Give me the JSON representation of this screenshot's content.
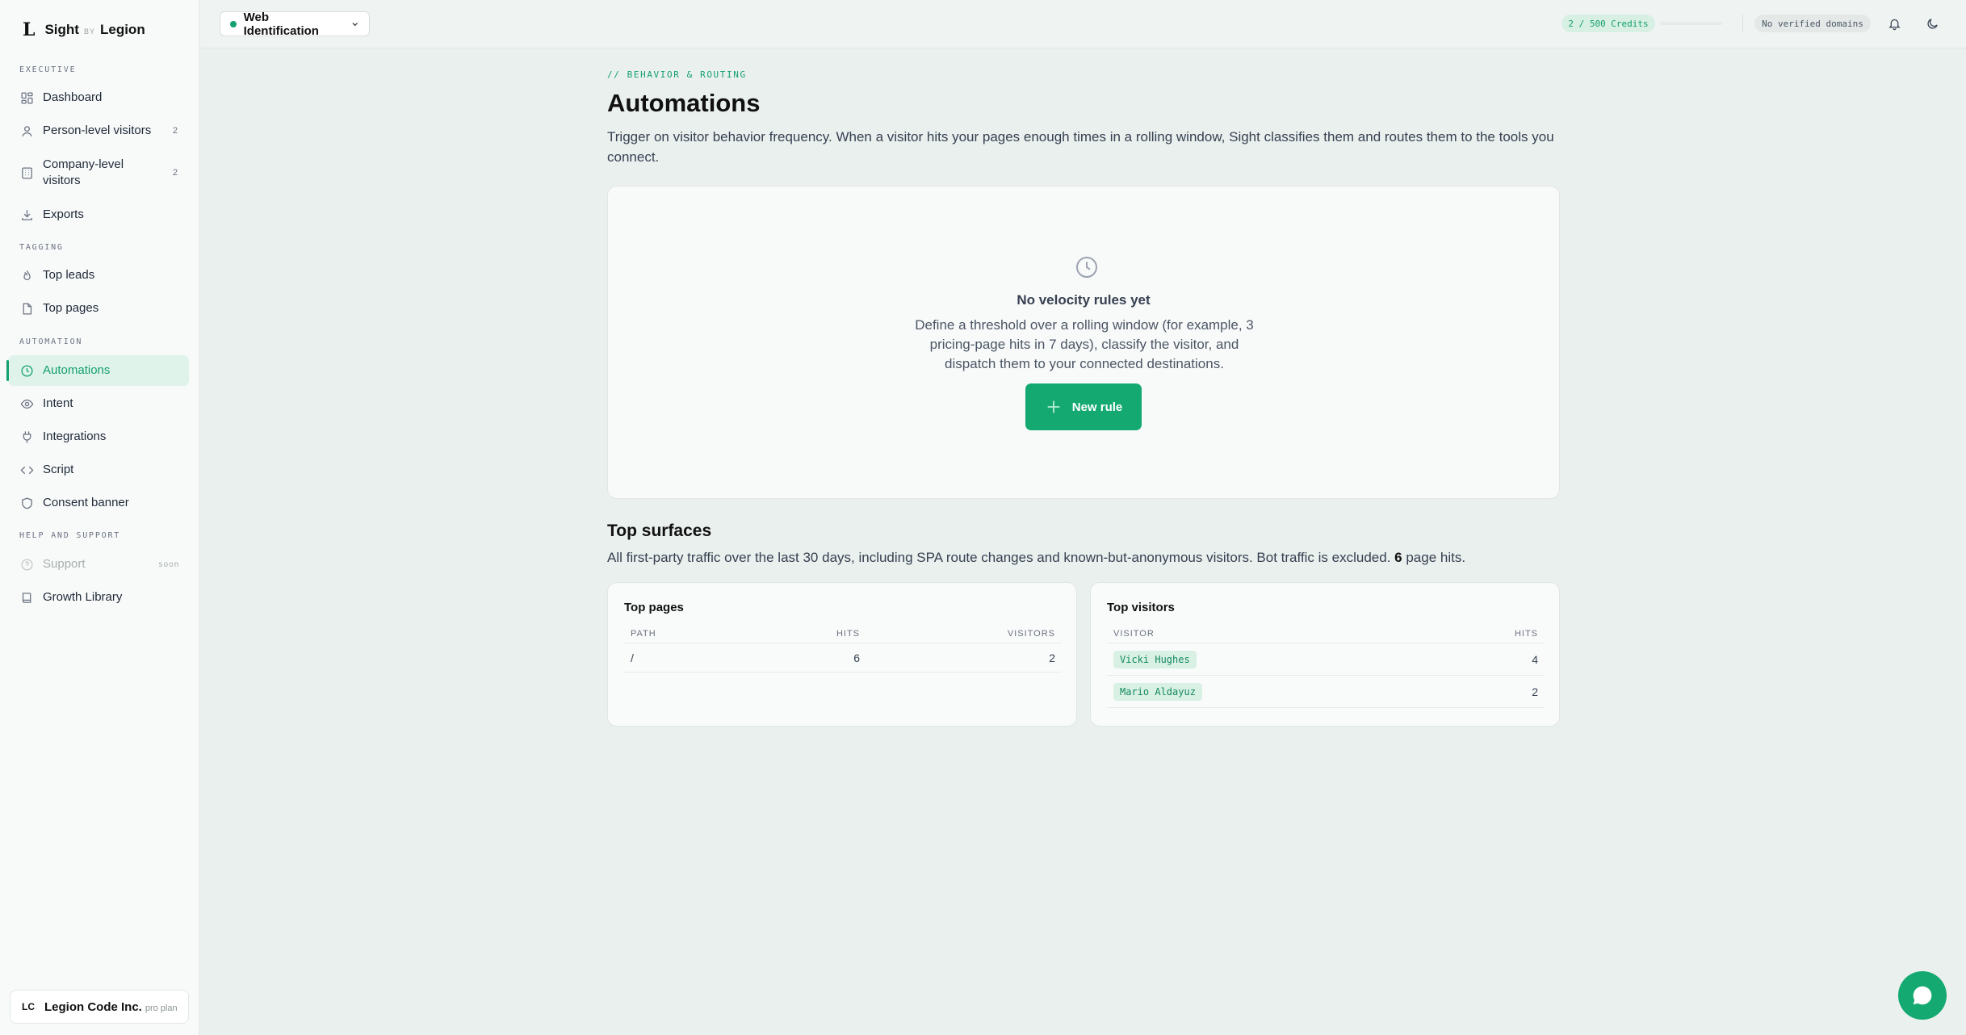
{
  "brand": {
    "logo": "L",
    "name_left": "Sight",
    "by": "BY",
    "name_right": "Legion"
  },
  "sidebar": {
    "sections": [
      {
        "label": "EXECUTIVE"
      },
      {
        "label": "TAGGING"
      },
      {
        "label": "AUTOMATION"
      },
      {
        "label": "HELP AND SUPPORT"
      }
    ],
    "items": [
      {
        "label": "Dashboard",
        "icon": "grid-icon"
      },
      {
        "label": "Person-level visitors",
        "count": "2",
        "icon": "user-icon"
      },
      {
        "label": "Company-level visitors",
        "count": "2",
        "icon": "building-icon"
      },
      {
        "label": "Exports",
        "icon": "download-icon"
      },
      {
        "label": "Top leads",
        "icon": "flame-icon"
      },
      {
        "label": "Top pages",
        "icon": "file-icon"
      },
      {
        "label": "Automations",
        "icon": "clock-icon",
        "active": true
      },
      {
        "label": "Intent",
        "icon": "eye-icon"
      },
      {
        "label": "Integrations",
        "icon": "plug-icon"
      },
      {
        "label": "Script",
        "icon": "code-icon"
      },
      {
        "label": "Consent banner",
        "icon": "shield-icon"
      },
      {
        "label": "Support",
        "badge": "soon",
        "icon": "help-circle-icon",
        "disabled": true
      },
      {
        "label": "Growth Library",
        "icon": "book-icon"
      }
    ],
    "account": {
      "initials": "LC",
      "name": "Legion Code Inc.",
      "plan": "pro plan"
    }
  },
  "topbar": {
    "workspace": "Web Identification",
    "credits": "2 / 500 Credits",
    "credits_used_fraction": 0.004,
    "domains": "No verified domains"
  },
  "main": {
    "eyebrow": "// BEHAVIOR & ROUTING",
    "title": "Automations",
    "description": "Trigger on visitor behavior frequency. When a visitor hits your pages enough times in a rolling window, Sight classifies them and routes them to the tools you connect.",
    "empty": {
      "title": "No velocity rules yet",
      "description": "Define a threshold over a rolling window (for example, 3 pricing-page hits in 7 days), classify the visitor, and dispatch them to your connected destinations.",
      "button": "New rule"
    },
    "surfaces": {
      "title": "Top surfaces",
      "description_before": "All first-party traffic over the last 30 days, including SPA route changes and known-but-anonymous visitors. Bot traffic is excluded. ",
      "total_hits": "6",
      "description_after": " page hits."
    },
    "top_pages": {
      "title": "Top pages",
      "columns": [
        "PATH",
        "HITS",
        "VISITORS"
      ],
      "rows": [
        {
          "path": "/",
          "hits": "6",
          "visitors": "2"
        }
      ]
    },
    "top_visitors": {
      "title": "Top visitors",
      "columns": [
        "VISITOR",
        "HITS"
      ],
      "rows": [
        {
          "visitor": "Vicki Hughes",
          "hits": "4"
        },
        {
          "visitor": "Mario Aldayuz",
          "hits": "2"
        }
      ]
    }
  },
  "colors": {
    "accent": "#14a06f",
    "accent_bg": "#dff3ea",
    "button": "#14a971"
  }
}
